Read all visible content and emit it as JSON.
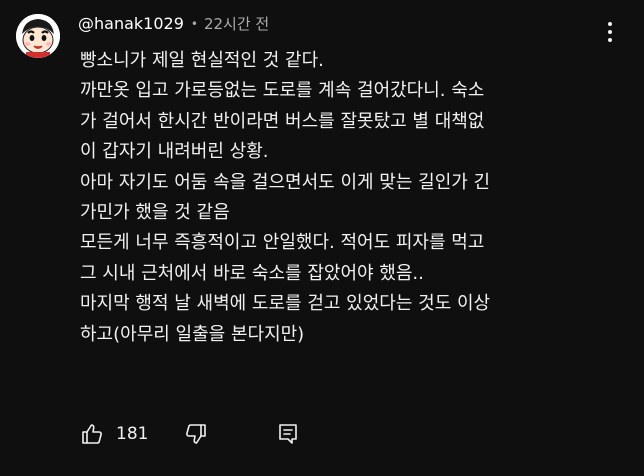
{
  "comment": {
    "username": "@hanak1029",
    "separator": "•",
    "time": "22시간 전",
    "lines": [
      "빵소니가 제일 현실적인 것 같다.",
      "까만옷 입고 가로등없는 도로를 계속 걸어갔다니. 숙소",
      "가 걸어서 한시간 반이라면 버스를 잘못탔고 별 대책없",
      "이 갑자기 내려버린 상황.",
      "아마 자기도 어둠 속을 걸으면서도 이게 맞는 길인가 긴",
      "가민가 했을 것 같음",
      "모든게 너무 즉흥적이고 안일했다. 적어도 피자를 먹고",
      "그 시내 근처에서 바로 숙소를 잡았어야 했음..",
      "마지막 행적 날 새벽에 도로를 걷고 있었다는 것도 이상",
      "하고(아무리 일출을 본다지만)"
    ],
    "like_count": "181"
  },
  "icons": {
    "avatar": "cartoon-character-avatar",
    "menu": "more-vertical-icon",
    "like": "thumbs-up-icon",
    "dislike": "thumbs-down-icon",
    "reply": "reply-comment-icon"
  },
  "colors": {
    "background": "#0f0f0f",
    "text": "#f1f1f1",
    "secondary_text": "#aaaaaa"
  }
}
